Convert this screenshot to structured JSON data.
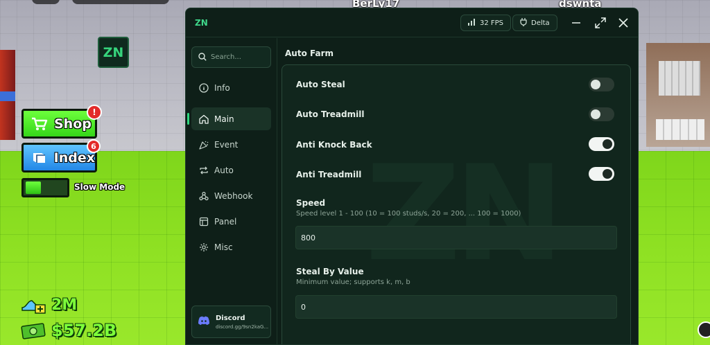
{
  "game": {
    "players": [
      "BerLy17",
      "dswnta"
    ],
    "logo_text": "ZN",
    "shop_label": "Shop",
    "shop_badge": "!",
    "index_label": "Index",
    "index_badge": "6",
    "slow_mode_label": "Slow Mode",
    "speed_stat": "2M",
    "cash_stat": "$57.2B"
  },
  "window": {
    "logo": "ZN",
    "fps_label": "32 FPS",
    "executor_label": "Delta",
    "icons": {
      "fps": "signal-bars-icon",
      "executor": "plug-icon",
      "minimize": "minimize-icon",
      "maximize": "maximize-icon",
      "close": "close-icon"
    }
  },
  "sidebar": {
    "search_placeholder": "Search...",
    "items": [
      {
        "label": "Info",
        "icon": "info-icon",
        "active": false
      },
      {
        "label": "Main",
        "icon": "home-icon",
        "active": true
      },
      {
        "label": "Event",
        "icon": "party-icon",
        "active": false
      },
      {
        "label": "Auto",
        "icon": "repeat-icon",
        "active": false
      },
      {
        "label": "Webhook",
        "icon": "webhook-icon",
        "active": false
      },
      {
        "label": "Panel",
        "icon": "panel-icon",
        "active": false
      },
      {
        "label": "Misc",
        "icon": "gear-icon",
        "active": false
      }
    ],
    "discord": {
      "title": "Discord",
      "link": "discord.gg/9sn2kaG..."
    }
  },
  "content": {
    "section_title": "Auto Farm",
    "toggles": [
      {
        "label": "Auto Steal",
        "on": false
      },
      {
        "label": "Auto Treadmill",
        "on": false
      },
      {
        "label": "Anti Knock Back",
        "on": true
      },
      {
        "label": "Anti Treadmill",
        "on": true
      }
    ],
    "speed": {
      "label": "Speed",
      "description": "Speed level 1 - 100 (10 = 100 studs/s, 20 = 200, ... 100 = 1000)",
      "value": "800"
    },
    "steal_by_value": {
      "label": "Steal By Value",
      "description": "Minimum value; supports k, m, b",
      "value": "0"
    }
  }
}
